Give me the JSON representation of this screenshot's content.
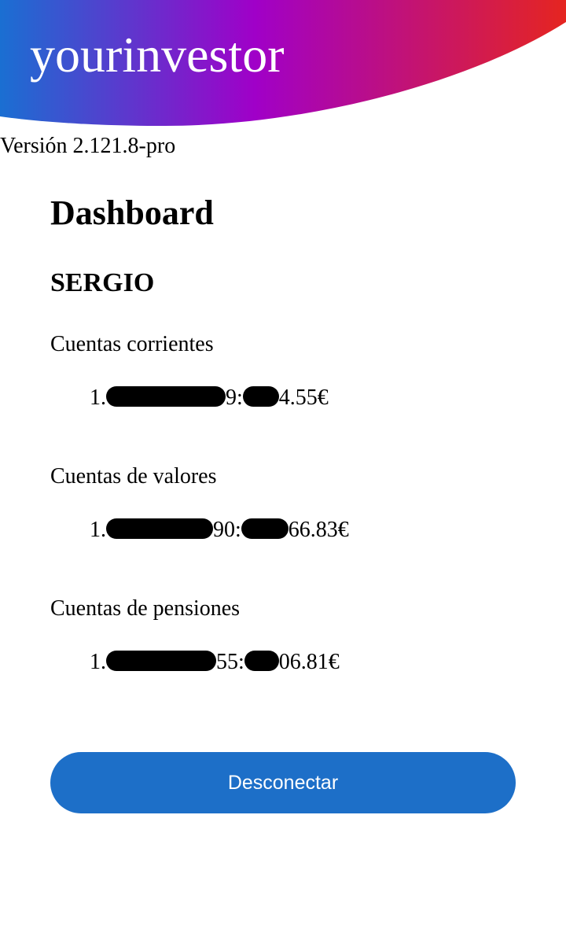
{
  "header": {
    "brand": "yourinvestor",
    "gradient_colors": [
      "#1a6fd2",
      "#a000c8",
      "#e52520"
    ]
  },
  "version_text": "Versión 2.121.8-pro",
  "dashboard": {
    "title": "Dashboard",
    "user_name": "SERGIO",
    "sections": [
      {
        "title": "Cuentas corrientes",
        "accounts": [
          {
            "prefix": "1.",
            "id_tail": "9:",
            "amount_tail": "4.55€"
          }
        ]
      },
      {
        "title": "Cuentas de valores",
        "accounts": [
          {
            "prefix": "1.",
            "id_tail": "90:",
            "amount_tail": "66.83€"
          }
        ]
      },
      {
        "title": "Cuentas de pensiones",
        "accounts": [
          {
            "prefix": "1.",
            "id_tail": "55:",
            "amount_tail": "06.81€"
          }
        ]
      }
    ]
  },
  "actions": {
    "logout_label": "Desconectar",
    "button_color": "#1d6fc8"
  }
}
